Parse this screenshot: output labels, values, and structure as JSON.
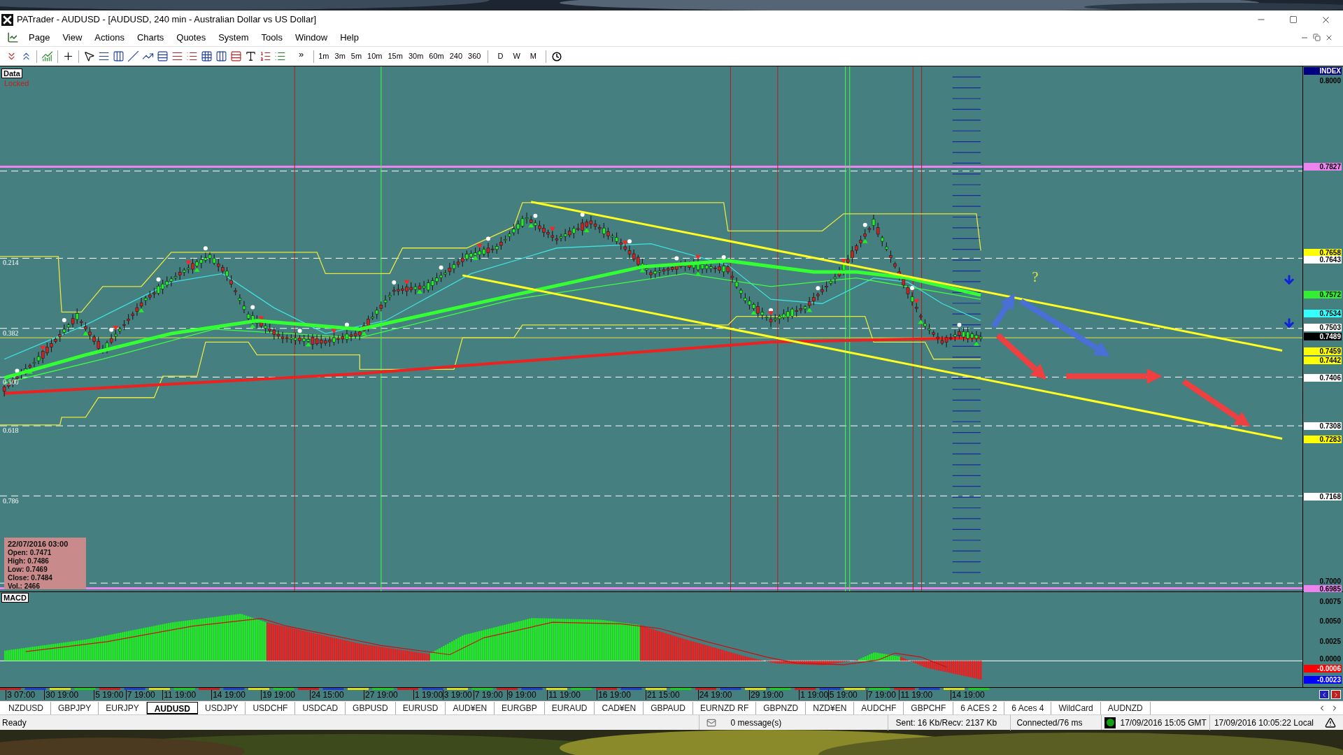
{
  "window": {
    "title": "PATrader - AUDUSD - [AUDUSD, 240 min - Australian Dollar vs US Dollar]"
  },
  "menu": [
    "Page",
    "View",
    "Actions",
    "Charts",
    "Quotes",
    "System",
    "Tools",
    "Window",
    "Help"
  ],
  "toolbar": {
    "more": "»",
    "timeframes": [
      "1m",
      "3m",
      "5m",
      "10m",
      "15m",
      "30m",
      "60m",
      "240",
      "360"
    ],
    "periods": [
      "D",
      "W",
      "M"
    ]
  },
  "chart": {
    "data_label": "Data",
    "lock_label": "Locked",
    "fib_levels": [
      "0.214",
      "0.382",
      "0.500",
      "0.618",
      "0.786"
    ],
    "annotation": "?",
    "info": {
      "date": "22/07/2016 03:00",
      "lines": [
        "Open: 0.7471",
        "High: 0.7486",
        "Low: 0.7469",
        "Close: 0.7484",
        "Vol.: 2466"
      ]
    },
    "price_axis": [
      {
        "text": "INDEX",
        "color": "#000080"
      },
      {
        "text": "0.8000"
      },
      {
        "text": "0.7827",
        "color": "#ee82ee"
      },
      {
        "text": "0.7658",
        "color": "#ffff00"
      },
      {
        "text": "0.7643",
        "color": "#ffffff"
      },
      {
        "text": "0.7572",
        "color": "#33ee33"
      },
      {
        "text": "0.7534",
        "color": "#33ffff"
      },
      {
        "text": "0.7503",
        "color": "#ffffff"
      },
      {
        "text": "0.7489",
        "color": "#000000"
      },
      {
        "text": "0.7459",
        "color": "#ffff00"
      },
      {
        "text": "0.7442",
        "color": "#ffff00"
      },
      {
        "text": "0.7406",
        "color": "#ffffff"
      },
      {
        "text": "0.7308",
        "color": "#ffffff"
      },
      {
        "text": "0.7283",
        "color": "#ffff00"
      },
      {
        "text": "0.7168",
        "color": "#ffffff"
      },
      {
        "text": "0.7000"
      },
      {
        "text": "0.6985",
        "color": "#ee82ee"
      }
    ]
  },
  "macd": {
    "label": "MACD",
    "axis": [
      {
        "text": "0.0075"
      },
      {
        "text": "0.0050"
      },
      {
        "text": "0.0025"
      },
      {
        "text": "0.0000"
      },
      {
        "text": "-0.0006",
        "color": "#ff0000"
      },
      {
        "text": "-0.0023",
        "color": "#0000ff"
      }
    ]
  },
  "time_axis": [
    "3 07:00",
    "30 19:00",
    "5 19:00",
    "7 19:00",
    "11 19:00",
    "14 19:00",
    "19 19:00",
    "24 15:00",
    "27 19:00",
    "1 19:00",
    "3 19:00",
    "7 19:00",
    "9 19:00",
    "11 19:00",
    "16 19:00",
    "21 15:00",
    "24 19:00",
    "29 19:00",
    "1 19:00",
    "5 19:00",
    "7 19:00",
    "11 19:00",
    "14 19:00"
  ],
  "tabs": [
    {
      "label": "NZDUSD",
      "selected": false
    },
    {
      "label": "GBPJPY",
      "selected": false
    },
    {
      "label": "EURJPY",
      "selected": false
    },
    {
      "label": "AUDUSD",
      "selected": true
    },
    {
      "label": "USDJPY",
      "selected": false
    },
    {
      "label": "USDCHF",
      "selected": false
    },
    {
      "label": "USDCAD",
      "selected": false
    },
    {
      "label": "GBPUSD",
      "selected": false
    },
    {
      "label": "EURUSD",
      "selected": false
    },
    {
      "label": "AUD¥EN",
      "selected": false
    },
    {
      "label": "EURGBP",
      "selected": false
    },
    {
      "label": "EURAUD",
      "selected": false
    },
    {
      "label": "CAD¥EN",
      "selected": false
    },
    {
      "label": "GBPAUD",
      "selected": false
    },
    {
      "label": "EURNZD RF",
      "selected": false
    },
    {
      "label": "GBPNZD",
      "selected": false
    },
    {
      "label": "NZD¥EN",
      "selected": false
    },
    {
      "label": "AUDCHF",
      "selected": false
    },
    {
      "label": "GBPCHF",
      "selected": false
    },
    {
      "label": "6 ACES 2",
      "selected": false
    },
    {
      "label": "6 Aces 4",
      "selected": false
    },
    {
      "label": "WildCard",
      "selected": false
    },
    {
      "label": "AUDNZD",
      "selected": false
    }
  ],
  "status_bar": {
    "state": "Ready",
    "messages": "0 message(s)",
    "traffic": "Sent: 16 Kb/Recv: 2137 Kb",
    "connection": "Connected/76 ms",
    "gmt_time": "17/09/2016 15:05 GMT",
    "local_time": "17/09/2016 10:05:22 Local"
  }
}
